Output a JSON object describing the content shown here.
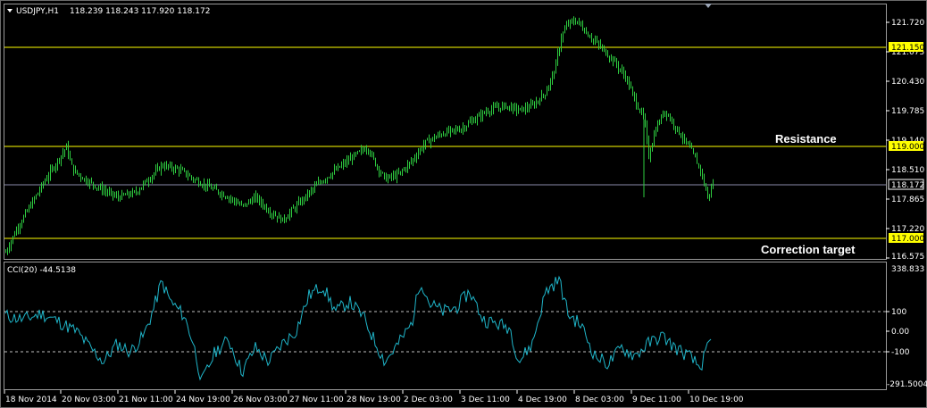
{
  "header": {
    "symbol": "USDJPY,H1",
    "ohlc": "118.239 118.243 117.920 118.172"
  },
  "price_axis": {
    "ticks": [
      "121.720",
      "121.075",
      "120.430",
      "119.785",
      "119.140",
      "118.510",
      "117.865",
      "117.220",
      "116.575"
    ],
    "current_price": "118.172"
  },
  "levels": [
    {
      "price": 121.15,
      "label": "121.150",
      "color": "#ffff00"
    },
    {
      "price": 119.0,
      "label": "119.000",
      "color": "#ffff00"
    },
    {
      "price": 117.0,
      "label": "117.000",
      "color": "#ffff00"
    }
  ],
  "annotations": {
    "resistance": "Resistance",
    "correction": "Correction target"
  },
  "indicator": {
    "title": "CCI(20) -44.5138",
    "ticks": [
      "338.833",
      "100",
      "0.00",
      "-100",
      "-291.5004"
    ]
  },
  "time_axis": [
    "18 Nov 2014",
    "20 Nov 03:00",
    "21 Nov 11:00",
    "24 Nov 19:00",
    "26 Nov 03:00",
    "27 Nov 11:00",
    "28 Nov 19:00",
    "2 Dec 03:00",
    "3 Dec 11:00",
    "4 Dec 19:00",
    "8 Dec 03:00",
    "9 Dec 11:00",
    "10 Dec 19:00"
  ],
  "colors": {
    "candles": "#2ecc40",
    "cci": "#1fb5c9",
    "current_line": "#8a8aaa",
    "grid_dash": "#bfbfbf"
  },
  "chart_data": {
    "type": "line",
    "title": "USDJPY,H1",
    "xlabel": "",
    "ylabel": "",
    "ylim": [
      116.4,
      121.9
    ],
    "x": [
      "18 Nov",
      "20 Nov",
      "21 Nov",
      "24 Nov",
      "26 Nov",
      "27 Nov",
      "28 Nov",
      "2 Dec",
      "3 Dec",
      "4 Dec",
      "8 Dec",
      "9 Dec",
      "10 Dec"
    ],
    "anchors": [
      [
        0,
        116.7
      ],
      [
        12,
        117.2
      ],
      [
        30,
        117.8
      ],
      [
        45,
        118.3
      ],
      [
        55,
        118.6
      ],
      [
        68,
        119.0
      ],
      [
        75,
        118.5
      ],
      [
        88,
        118.3
      ],
      [
        105,
        118.1
      ],
      [
        125,
        117.9
      ],
      [
        145,
        118.0
      ],
      [
        160,
        118.3
      ],
      [
        175,
        118.6
      ],
      [
        195,
        118.5
      ],
      [
        210,
        118.3
      ],
      [
        230,
        118.1
      ],
      [
        250,
        117.9
      ],
      [
        265,
        117.7
      ],
      [
        280,
        117.9
      ],
      [
        295,
        117.6
      ],
      [
        310,
        117.4
      ],
      [
        330,
        117.8
      ],
      [
        350,
        118.2
      ],
      [
        370,
        118.5
      ],
      [
        390,
        118.8
      ],
      [
        405,
        119.0
      ],
      [
        415,
        118.6
      ],
      [
        425,
        118.3
      ],
      [
        440,
        118.4
      ],
      [
        455,
        118.7
      ],
      [
        470,
        119.1
      ],
      [
        490,
        119.3
      ],
      [
        510,
        119.4
      ],
      [
        525,
        119.6
      ],
      [
        540,
        119.8
      ],
      [
        560,
        119.9
      ],
      [
        575,
        119.8
      ],
      [
        590,
        119.9
      ],
      [
        605,
        120.2
      ],
      [
        615,
        120.7
      ],
      [
        622,
        121.4
      ],
      [
        630,
        121.7
      ],
      [
        640,
        121.75
      ],
      [
        650,
        121.5
      ],
      [
        665,
        121.2
      ],
      [
        680,
        120.9
      ],
      [
        695,
        120.5
      ],
      [
        705,
        120.0
      ],
      [
        715,
        119.6
      ],
      [
        720,
        118.8
      ],
      [
        728,
        119.4
      ],
      [
        738,
        119.8
      ],
      [
        748,
        119.5
      ],
      [
        758,
        119.2
      ],
      [
        768,
        118.9
      ],
      [
        778,
        118.5
      ],
      [
        786,
        117.9
      ],
      [
        792,
        118.2
      ]
    ],
    "series": [
      {
        "values": [
          116.7,
          117.2,
          117.8,
          118.3,
          118.6,
          119.0,
          118.5,
          118.3,
          118.1,
          117.9,
          118.0,
          118.3,
          118.6,
          118.5,
          118.3,
          118.1,
          117.9,
          117.7,
          117.9,
          117.6,
          117.4,
          117.8,
          118.2,
          118.5,
          118.8,
          119.0,
          118.6,
          118.3,
          118.4,
          118.7,
          119.1,
          119.3,
          119.4,
          119.6,
          119.8,
          119.9,
          119.8,
          119.9,
          120.2,
          120.7,
          121.4,
          121.7,
          121.75,
          121.5,
          121.2,
          120.9,
          120.5,
          120.0,
          119.6,
          118.8,
          119.4,
          119.8,
          119.5,
          119.2,
          118.9,
          118.5,
          117.9,
          118.2
        ]
      }
    ],
    "cci": {
      "ylim": [
        -291.5004,
        338.833
      ],
      "anchors": [
        [
          0,
          80
        ],
        [
          20,
          60
        ],
        [
          40,
          90
        ],
        [
          60,
          50
        ],
        [
          80,
          0
        ],
        [
          95,
          -80
        ],
        [
          110,
          -150
        ],
        [
          125,
          -60
        ],
        [
          140,
          -100
        ],
        [
          155,
          -20
        ],
        [
          165,
          100
        ],
        [
          175,
          250
        ],
        [
          185,
          150
        ],
        [
          200,
          80
        ],
        [
          210,
          -50
        ],
        [
          220,
          -250
        ],
        [
          235,
          -100
        ],
        [
          250,
          -40
        ],
        [
          265,
          -200
        ],
        [
          280,
          -80
        ],
        [
          295,
          -150
        ],
        [
          310,
          -60
        ],
        [
          325,
          0
        ],
        [
          340,
          180
        ],
        [
          355,
          230
        ],
        [
          370,
          100
        ],
        [
          385,
          150
        ],
        [
          400,
          80
        ],
        [
          415,
          -60
        ],
        [
          425,
          -150
        ],
        [
          440,
          -60
        ],
        [
          455,
          40
        ],
        [
          465,
          260
        ],
        [
          475,
          140
        ],
        [
          490,
          100
        ],
        [
          505,
          120
        ],
        [
          520,
          200
        ],
        [
          535,
          60
        ],
        [
          550,
          40
        ],
        [
          565,
          20
        ],
        [
          575,
          -150
        ],
        [
          590,
          -60
        ],
        [
          605,
          200
        ],
        [
          620,
          260
        ],
        [
          630,
          90
        ],
        [
          645,
          30
        ],
        [
          660,
          -120
        ],
        [
          675,
          -160
        ],
        [
          690,
          -80
        ],
        [
          705,
          -120
        ],
        [
          720,
          -60
        ],
        [
          735,
          -20
        ],
        [
          750,
          -80
        ],
        [
          765,
          -120
        ],
        [
          778,
          -180
        ],
        [
          786,
          -90
        ],
        [
          790,
          -44.5138
        ]
      ]
    }
  }
}
